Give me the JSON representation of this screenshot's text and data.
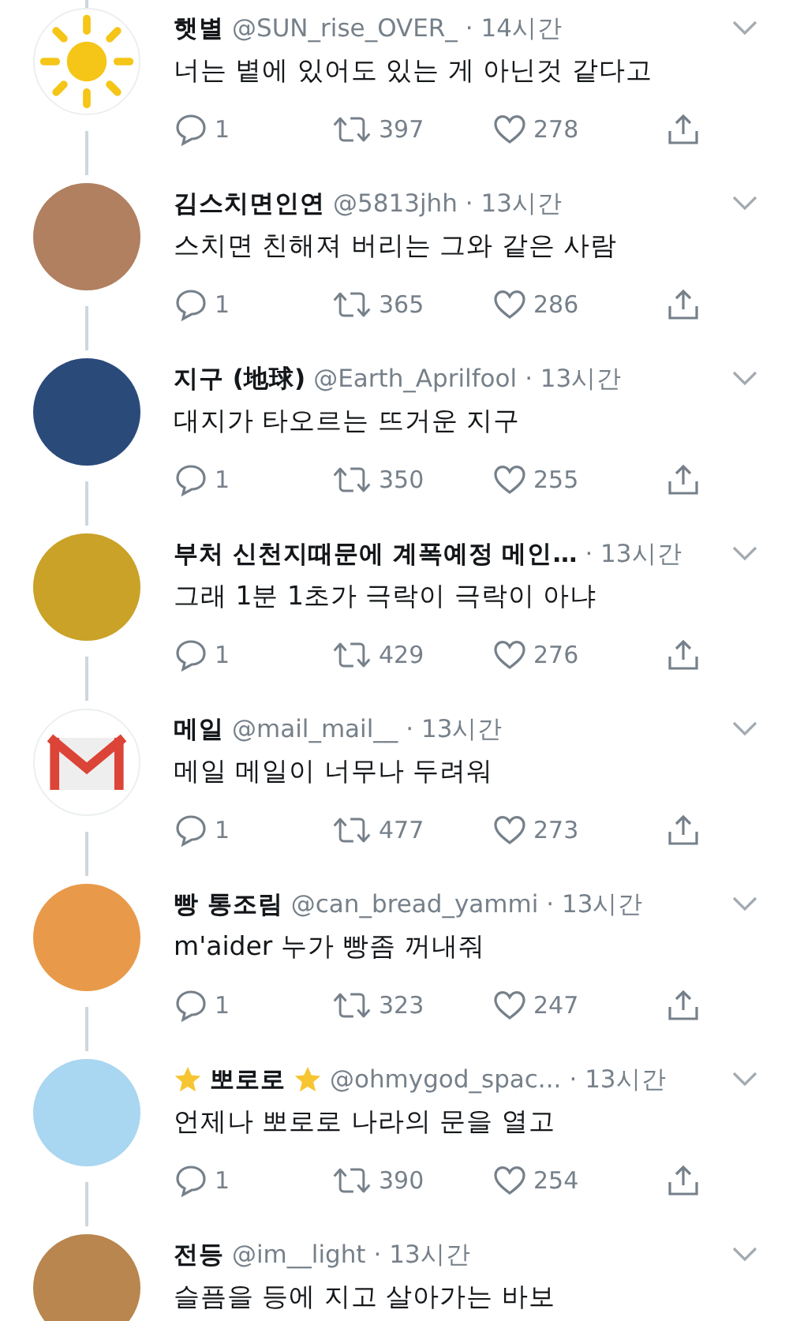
{
  "tweets": [
    {
      "name": "햇별",
      "handle": "@SUN_rise_OVER_",
      "time": "· 14시간",
      "text": "너는 볕에 있어도 있는 게 아닌것 같다고",
      "avatar": {
        "kind": "sun",
        "color": "#f5c518"
      },
      "stats": {
        "replies": "1",
        "retweets": "397",
        "likes": "278"
      }
    },
    {
      "name": "김스치면인연",
      "handle": "@5813jhh",
      "time": "· 13시간",
      "text": "스치면 친해져 버리는 그와 같은 사람",
      "avatar": {
        "kind": "photo",
        "color": "#b08060"
      },
      "stats": {
        "replies": "1",
        "retweets": "365",
        "likes": "286"
      }
    },
    {
      "name": "지구 (地球)",
      "handle": "@Earth_Aprilfool",
      "time": "· 13시간",
      "text": "대지가 타오르는 뜨거운 지구",
      "avatar": {
        "kind": "photo",
        "color": "#2a4a7a"
      },
      "stats": {
        "replies": "1",
        "retweets": "350",
        "likes": "255"
      }
    },
    {
      "name": "부처 신천지때문에 계폭예정 메인…",
      "time": "· 13시간",
      "text": "그래 1분 1초가 극락이 극락이 아냐",
      "avatar": {
        "kind": "photo",
        "color": "#c9a227"
      },
      "stats": {
        "replies": "1",
        "retweets": "429",
        "likes": "276"
      }
    },
    {
      "name": "메일",
      "handle": "@mail_mail__",
      "time": "· 13시간",
      "text": "메일 메일이 너무나 두려워",
      "avatar": {
        "kind": "mail",
        "color": "#db4437"
      },
      "stats": {
        "replies": "1",
        "retweets": "477",
        "likes": "273"
      }
    },
    {
      "name": "빵 통조림",
      "handle": "@can_bread_yammi",
      "time": "· 13시간",
      "text": "m'aider 누가 빵좀 꺼내줘",
      "avatar": {
        "kind": "photo",
        "color": "#e89a4a"
      },
      "stats": {
        "replies": "1",
        "retweets": "323",
        "likes": "247"
      }
    },
    {
      "name": "뽀로로",
      "decorated": true,
      "handle": "@ohmygod_spac...",
      "time": "· 13시간",
      "text": "언제나 뽀로로 나라의 문을 열고",
      "avatar": {
        "kind": "photo",
        "color": "#a9d6f0"
      },
      "stats": {
        "replies": "1",
        "retweets": "390",
        "likes": "254"
      }
    },
    {
      "name": "전등",
      "handle": "@im__light",
      "time": "· 13시간",
      "text": "슬픔을 등에 지고 살아가는 바보",
      "avatar": {
        "kind": "photo",
        "color": "#b8864e"
      }
    }
  ]
}
